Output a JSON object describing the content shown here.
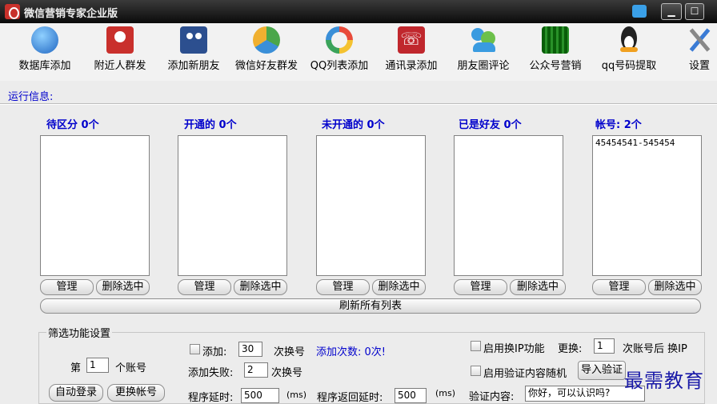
{
  "window": {
    "title": "微信营销专家企业版",
    "minimize": "▁",
    "maximize": "☐",
    "close": "✕"
  },
  "toolbar": [
    {
      "label": "数据库添加",
      "icon": "globe-icon",
      "color": "#2f7fd6"
    },
    {
      "label": "附近人群发",
      "icon": "location-pin-icon",
      "color": "#c9302c"
    },
    {
      "label": "添加新朋友",
      "icon": "add-friend-icon",
      "color": "#2c4f8f"
    },
    {
      "label": "微信好友群发",
      "icon": "recycle-icon",
      "color": "#4aa64a"
    },
    {
      "label": "QQ列表添加",
      "icon": "qq-ring-icon",
      "color": "#e84a3a"
    },
    {
      "label": "通讯录添加",
      "icon": "phone-icon",
      "color": "#c0272d"
    },
    {
      "label": "朋友圈评论",
      "icon": "users-icon",
      "color": "#3a9be0"
    },
    {
      "label": "公众号营销",
      "icon": "qrcode-icon",
      "color": "#2f9a2f"
    },
    {
      "label": "qq号码提取",
      "icon": "penguin-icon",
      "color": "#222222"
    },
    {
      "label": "设置",
      "icon": "tools-icon",
      "color": "#3a7bd5"
    }
  ],
  "run_info": "运行信息:",
  "columns": [
    {
      "title": "待区分 0个",
      "items": []
    },
    {
      "title": "开通的 0个",
      "items": []
    },
    {
      "title": "未开通的 0个",
      "items": []
    },
    {
      "title": "已是好友 0个",
      "items": []
    },
    {
      "title": "帐号: 2个",
      "items": [
        "45454541-545454"
      ]
    }
  ],
  "column_buttons": {
    "manage": "管理",
    "delete": "删除选中"
  },
  "refresh": "刷新所有列表",
  "filter": {
    "group_title": "筛选功能设置",
    "nth_prefix": "第",
    "nth_value": "1",
    "nth_suffix": "个账号",
    "auto_login": "自动登录",
    "switch_account": "更换帐号",
    "add_label": "添加:",
    "add_value": "30",
    "add_suffix": "次换号",
    "add_count": "添加次数: 0次!",
    "fail_label": "添加失败:",
    "fail_value": "2",
    "fail_suffix": "次换号",
    "delay_label": "程序延时:",
    "delay_value": "500",
    "delay_unit": "(ms)",
    "return_delay_label": "程序返回延时:",
    "return_delay_value": "500",
    "return_delay_unit": "(ms)",
    "ip_switch": "启用换IP功能",
    "change_label": "更换:",
    "change_value": "1",
    "change_suffix": "次账号后 换IP",
    "verify_random": "启用验证内容随机",
    "import_verify": "导入验证",
    "verify_label": "验证内容:",
    "verify_value": "你好，可以认识吗?"
  },
  "watermark": "最需教育"
}
